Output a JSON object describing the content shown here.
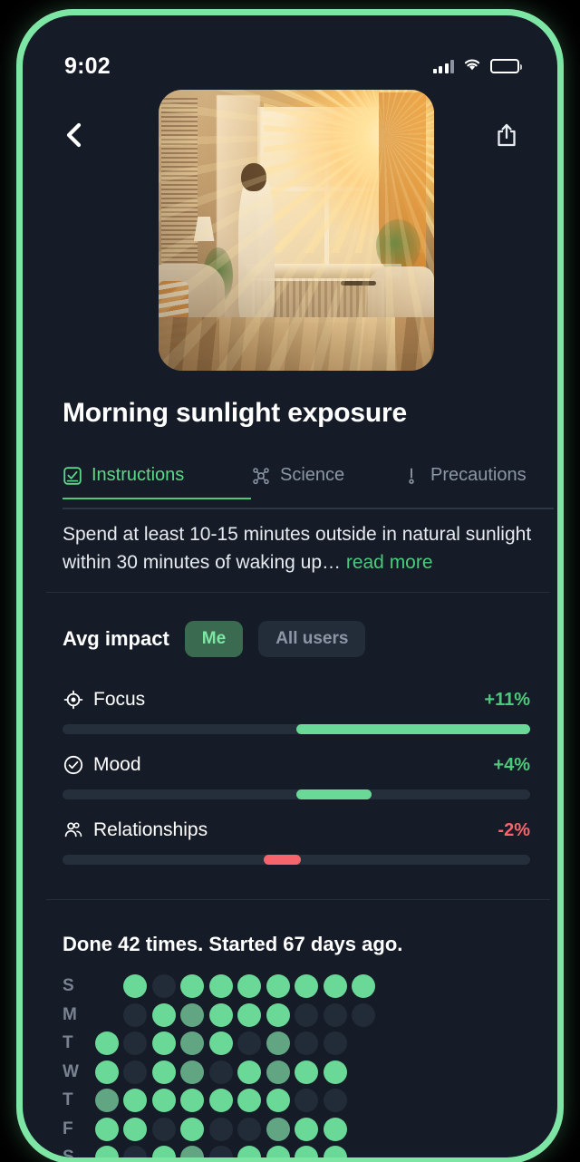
{
  "status_bar": {
    "time": "9:02",
    "signal_icon": "cellular-bars-icon",
    "wifi_icon": "wifi-icon",
    "battery_icon": "battery-icon"
  },
  "nav": {
    "back_icon": "chevron-left-icon",
    "share_icon": "share-icon"
  },
  "hero": {
    "image_name": "morning-sunlight-illustration",
    "alt": "Person standing at a sunlit window in the morning"
  },
  "page_title": "Morning sunlight exposure",
  "tabs": [
    {
      "label": "Instructions",
      "icon": "checkbox-check-icon",
      "active": true
    },
    {
      "label": "Science",
      "icon": "molecule-icon",
      "active": false
    },
    {
      "label": "Precautions",
      "icon": "alert-exclamation-icon",
      "active": false
    }
  ],
  "description": {
    "text": "Spend at least 10-15 minutes outside in natural sunlight within 30 minutes of waking up… ",
    "read_more": "read more"
  },
  "impact": {
    "label": "Avg impact",
    "segments": [
      {
        "label": "Me",
        "selected": true
      },
      {
        "label": "All users",
        "selected": false
      }
    ],
    "metrics": [
      {
        "name": "Focus",
        "icon": "focus-target-icon",
        "value": "+11%",
        "percent": 11,
        "positive": true
      },
      {
        "name": "Mood",
        "icon": "check-circle-icon",
        "value": "+4%",
        "percent": 4,
        "positive": true
      },
      {
        "name": "Relationships",
        "icon": "people-group-icon",
        "value": "-2%",
        "percent": -2,
        "positive": false
      }
    ]
  },
  "history": {
    "summary": "Done 42 times. Started 67 days ago.",
    "day_labels": [
      "S",
      "M",
      "T",
      "W",
      "T",
      "F",
      "S"
    ],
    "grid": [
      [
        "none",
        "full",
        "empty",
        "full",
        "full",
        "full",
        "full",
        "full",
        "full",
        "full"
      ],
      [
        "none",
        "empty",
        "full",
        "half",
        "full",
        "full",
        "full",
        "empty",
        "empty",
        "empty"
      ],
      [
        "full",
        "empty",
        "full",
        "half",
        "full",
        "empty",
        "half",
        "empty",
        "empty",
        "none"
      ],
      [
        "full",
        "empty",
        "full",
        "half",
        "empty",
        "full",
        "half",
        "full",
        "full",
        "none"
      ],
      [
        "half",
        "full",
        "full",
        "full",
        "full",
        "full",
        "full",
        "empty",
        "empty",
        "none"
      ],
      [
        "full",
        "full",
        "empty",
        "full",
        "empty",
        "empty",
        "half",
        "full",
        "full",
        "none"
      ],
      [
        "full",
        "empty",
        "full",
        "half",
        "empty",
        "full",
        "full",
        "full",
        "full",
        "none"
      ]
    ]
  },
  "colors": {
    "screen_bg": "#151c27",
    "frame": "#7ee6a4",
    "accent_green": "#4cc97c",
    "bar_green": "#6ad896",
    "negative_red": "#f5656b",
    "muted_text": "#8b97a4",
    "track": "#252e3b"
  }
}
